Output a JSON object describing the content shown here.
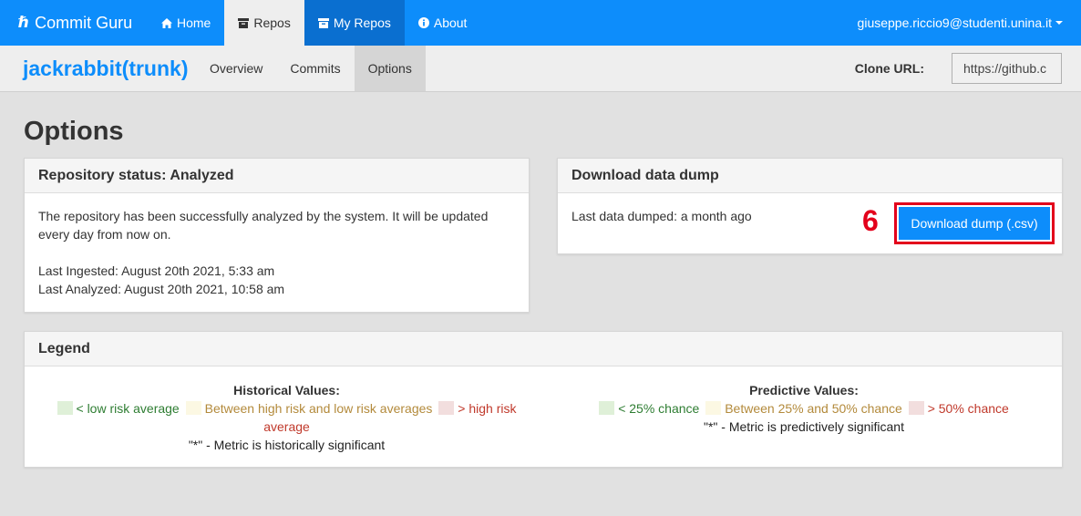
{
  "topnav": {
    "brand": "Commit Guru",
    "items": [
      {
        "label": "Home",
        "icon": "home-icon"
      },
      {
        "label": "Repos",
        "icon": "archive-icon"
      },
      {
        "label": "My Repos",
        "icon": "archive-icon"
      },
      {
        "label": "About",
        "icon": "info-icon"
      }
    ],
    "user": "giuseppe.riccio9@studenti.unina.it"
  },
  "subnav": {
    "repo": "jackrabbit(trunk)",
    "tabs": [
      {
        "label": "Overview"
      },
      {
        "label": "Commits"
      },
      {
        "label": "Options"
      }
    ],
    "clone_label": "Clone URL:",
    "clone_value": "https://github.c"
  },
  "page_title": "Options",
  "status_panel": {
    "title": "Repository status: Analyzed",
    "message": "The repository has been successfully analyzed by the system. It will be updated every day from now on.",
    "ingested": "Last Ingested: August 20th 2021, 5:33 am",
    "analyzed": "Last Analyzed: August 20th 2021, 10:58 am"
  },
  "dump_panel": {
    "title": "Download data dump",
    "last": "Last data dumped: a month ago",
    "button": "Download dump (.csv)",
    "annotation": "6"
  },
  "legend": {
    "title": "Legend",
    "historical": {
      "title": "Historical Values:",
      "low": "< low risk average",
      "mid": "Between high risk and low risk averages",
      "high": "> high risk average",
      "note": "\"*\" - Metric is historically significant"
    },
    "predictive": {
      "title": "Predictive Values:",
      "low": "< 25% chance",
      "mid": "Between 25% and 50% chance",
      "high": "> 50% chance",
      "note": "\"*\" - Metric is predictively significant"
    },
    "colors": {
      "low_swatch": "#dff0d8",
      "mid_swatch": "#fcf8e3",
      "high_swatch": "#f2dede"
    }
  },
  "colors": {
    "primary": "#0d8dfb",
    "annotation": "#e3001b"
  }
}
